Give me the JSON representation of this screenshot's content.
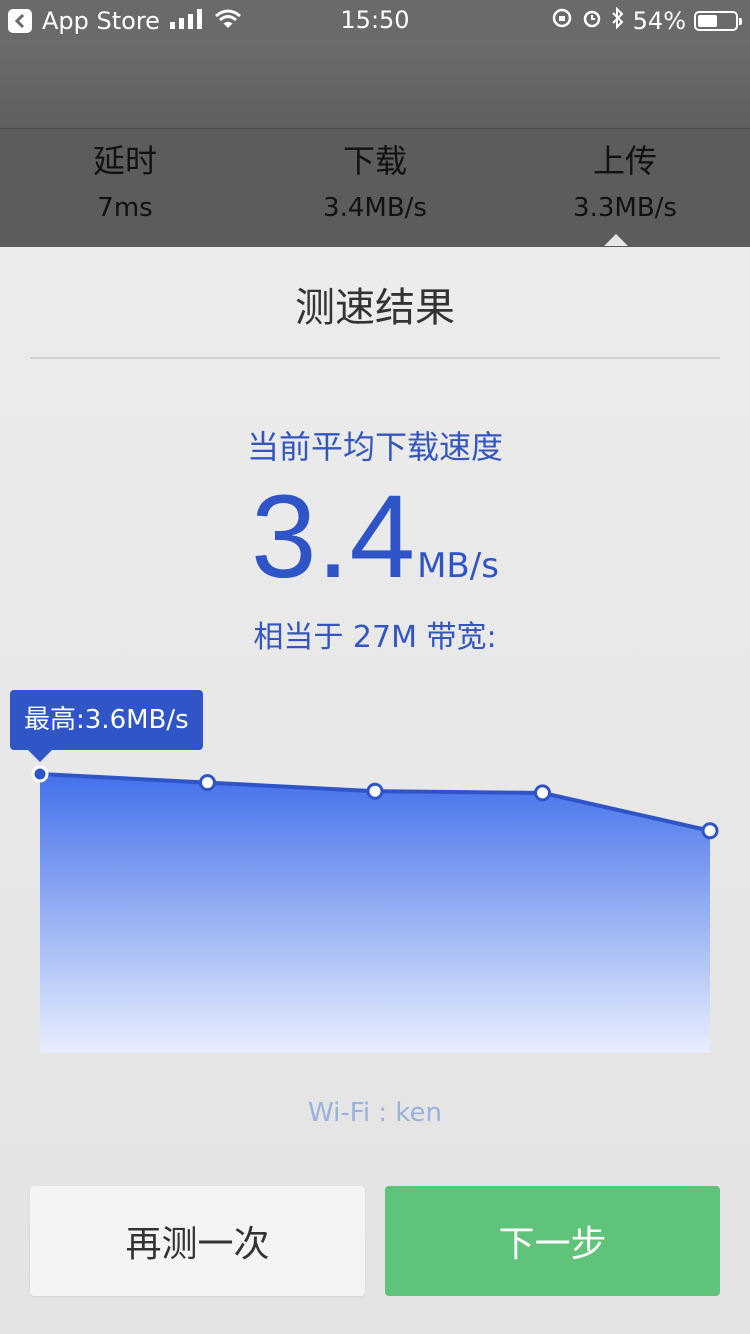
{
  "status_bar": {
    "back_app": "App Store",
    "time": "15:50",
    "battery": "54%",
    "battery_level": 0.54
  },
  "stats": [
    {
      "label": "延时",
      "value": "7ms"
    },
    {
      "label": "下载",
      "value": "3.4MB/s"
    },
    {
      "label": "上传",
      "value": "3.3MB/s"
    }
  ],
  "result": {
    "title": "测速结果",
    "avg_label": "当前平均下载速度",
    "speed_value": "3.4",
    "speed_unit": "MB/s",
    "equivalent": "相当于 27M 带宽:"
  },
  "chart_data": {
    "type": "area",
    "values": [
      3.6,
      3.55,
      3.5,
      3.49,
      3.27
    ],
    "annotation": "最高:3.6MB/s",
    "color": "#3a63e0"
  },
  "wifi": "Wi-Fi : ken",
  "buttons": {
    "retry": "再测一次",
    "next": "下一步"
  }
}
